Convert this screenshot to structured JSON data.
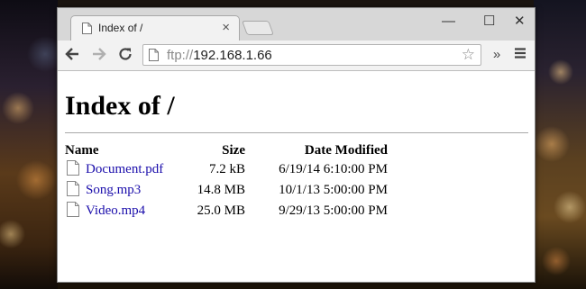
{
  "browser": {
    "tab_title": "Index of /",
    "url_scheme": "ftp://",
    "url_host": "192.168.1.66",
    "controls": {
      "minimize": "—",
      "maximize": "☐",
      "close": "✕"
    },
    "overflow": "»"
  },
  "page": {
    "heading": "Index of /",
    "columns": {
      "name": "Name",
      "size": "Size",
      "date": "Date Modified"
    },
    "files": [
      {
        "name": "Document.pdf",
        "size": "7.2 kB",
        "date": "6/19/14 6:10:00 PM"
      },
      {
        "name": "Song.mp3",
        "size": "14.8 MB",
        "date": "10/1/13 5:00:00 PM"
      },
      {
        "name": "Video.mp4",
        "size": "25.0 MB",
        "date": "9/29/13 5:00:00 PM"
      }
    ]
  },
  "icons": {
    "page": "page-icon",
    "file": "file-icon",
    "back": "back-arrow-icon",
    "forward": "forward-arrow-icon",
    "reload": "reload-icon",
    "bookmark": "star-icon",
    "menu": "hamburger-menu-icon"
  },
  "colors": {
    "link": "#1a0dab"
  }
}
